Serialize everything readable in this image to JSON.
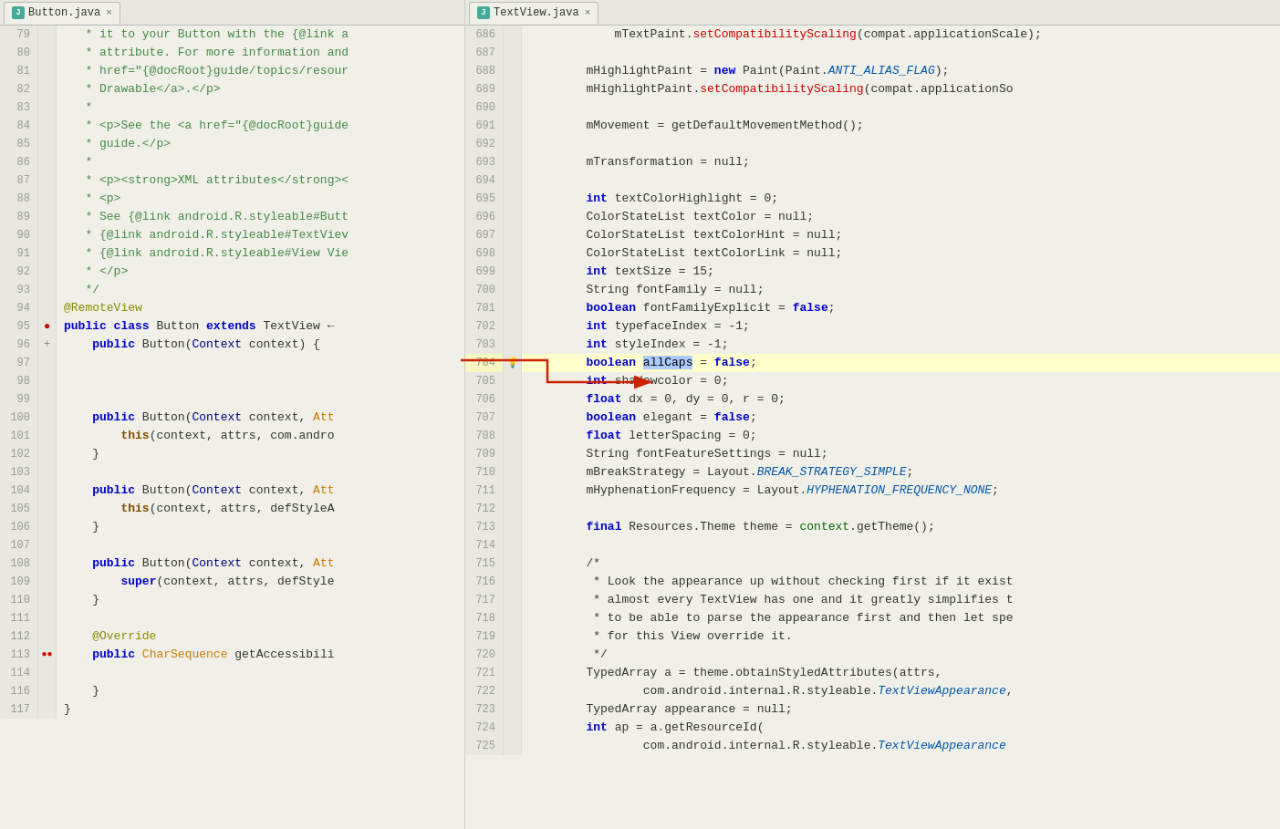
{
  "left_tab": {
    "icon_text": "J",
    "label": "Button.java",
    "close": "×"
  },
  "right_tab": {
    "icon_text": "J",
    "label": "TextView.java",
    "close": "×"
  },
  "left_lines": [
    {
      "num": "79",
      "gutter": "",
      "content": [
        {
          "t": "comment",
          "v": "   * it to your Button with the {@link a"
        }
      ]
    },
    {
      "num": "80",
      "gutter": "",
      "content": [
        {
          "t": "comment",
          "v": "   * attribute. For more information and"
        }
      ]
    },
    {
      "num": "81",
      "gutter": "",
      "content": [
        {
          "t": "comment",
          "v": "   * href=\"{@docRoot}guide/topics/resour"
        }
      ]
    },
    {
      "num": "82",
      "gutter": "",
      "content": [
        {
          "t": "comment",
          "v": "   * Drawable</a>.</p>"
        }
      ]
    },
    {
      "num": "83",
      "gutter": "",
      "content": [
        {
          "t": "comment",
          "v": "   *"
        }
      ]
    },
    {
      "num": "84",
      "gutter": "",
      "content": [
        {
          "t": "comment",
          "v": "   * <p>See the <a href=\"{@docRoot}guide"
        }
      ]
    },
    {
      "num": "85",
      "gutter": "",
      "content": [
        {
          "t": "comment",
          "v": "   * guide.</p>"
        }
      ]
    },
    {
      "num": "86",
      "gutter": "",
      "content": [
        {
          "t": "comment",
          "v": "   *"
        }
      ]
    },
    {
      "num": "87",
      "gutter": "",
      "content": [
        {
          "t": "comment",
          "v": "   * <p><strong>XML attributes</strong><"
        }
      ]
    },
    {
      "num": "88",
      "gutter": "",
      "content": [
        {
          "t": "comment",
          "v": "   * <p>"
        }
      ]
    },
    {
      "num": "89",
      "gutter": "",
      "content": [
        {
          "t": "comment",
          "v": "   * See {@link android.R.styleable#Butt"
        }
      ]
    },
    {
      "num": "90",
      "gutter": "",
      "content": [
        {
          "t": "comment",
          "v": "   * {@link android.R.styleable#TextViev"
        }
      ]
    },
    {
      "num": "91",
      "gutter": "",
      "content": [
        {
          "t": "comment",
          "v": "   * {@link android.R.styleable#View Vie"
        }
      ]
    },
    {
      "num": "92",
      "gutter": "",
      "content": [
        {
          "t": "comment",
          "v": "   * </p>"
        }
      ]
    },
    {
      "num": "93",
      "gutter": "",
      "content": [
        {
          "t": "comment",
          "v": "   */"
        }
      ]
    },
    {
      "num": "94",
      "gutter": "",
      "content": [
        {
          "t": "annotation",
          "v": "@RemoteView"
        }
      ]
    },
    {
      "num": "95",
      "gutter": "●",
      "content": [
        {
          "t": "kw",
          "v": "public class"
        },
        {
          "t": "normal",
          "v": " Button "
        },
        {
          "t": "kw",
          "v": "extends"
        },
        {
          "t": "normal",
          "v": " TextView ←"
        }
      ]
    },
    {
      "num": "96",
      "gutter": "+",
      "content": [
        {
          "t": "normal",
          "v": "    "
        },
        {
          "t": "kw",
          "v": "public"
        },
        {
          "t": "normal",
          "v": " Button("
        },
        {
          "t": "type",
          "v": "Context"
        },
        {
          "t": "normal",
          "v": " context) {"
        }
      ]
    },
    {
      "num": "97",
      "gutter": "",
      "content": []
    },
    {
      "num": "98",
      "gutter": "",
      "content": []
    },
    {
      "num": "99",
      "gutter": "",
      "content": []
    },
    {
      "num": "100",
      "gutter": "",
      "content": [
        {
          "t": "normal",
          "v": "    "
        },
        {
          "t": "kw",
          "v": "public"
        },
        {
          "t": "normal",
          "v": " Button("
        },
        {
          "t": "type",
          "v": "Context"
        },
        {
          "t": "normal",
          "v": " context, "
        },
        {
          "t": "param",
          "v": "Att"
        }
      ]
    },
    {
      "num": "101",
      "gutter": "",
      "content": [
        {
          "t": "normal",
          "v": "        "
        },
        {
          "t": "kw2",
          "v": "this"
        },
        {
          "t": "normal",
          "v": "(context, attrs, com.andro"
        }
      ]
    },
    {
      "num": "102",
      "gutter": "",
      "content": [
        {
          "t": "normal",
          "v": "    }"
        }
      ]
    },
    {
      "num": "103",
      "gutter": "",
      "content": []
    },
    {
      "num": "104",
      "gutter": "",
      "content": [
        {
          "t": "normal",
          "v": "    "
        },
        {
          "t": "kw",
          "v": "public"
        },
        {
          "t": "normal",
          "v": " Button("
        },
        {
          "t": "type",
          "v": "Context"
        },
        {
          "t": "normal",
          "v": " context, "
        },
        {
          "t": "param",
          "v": "Att"
        }
      ]
    },
    {
      "num": "105",
      "gutter": "",
      "content": [
        {
          "t": "normal",
          "v": "        "
        },
        {
          "t": "kw2",
          "v": "this"
        },
        {
          "t": "normal",
          "v": "(context, attrs, defStyleA"
        }
      ]
    },
    {
      "num": "106",
      "gutter": "",
      "content": [
        {
          "t": "normal",
          "v": "    }"
        }
      ]
    },
    {
      "num": "107",
      "gutter": "",
      "content": []
    },
    {
      "num": "108",
      "gutter": "",
      "content": [
        {
          "t": "normal",
          "v": "    "
        },
        {
          "t": "kw",
          "v": "public"
        },
        {
          "t": "normal",
          "v": " Button("
        },
        {
          "t": "type",
          "v": "Context"
        },
        {
          "t": "normal",
          "v": " context, "
        },
        {
          "t": "param",
          "v": "Att"
        }
      ]
    },
    {
      "num": "109",
      "gutter": "",
      "content": [
        {
          "t": "normal",
          "v": "        "
        },
        {
          "t": "kw",
          "v": "super"
        },
        {
          "t": "normal",
          "v": "(context, attrs, defStyle"
        }
      ]
    },
    {
      "num": "110",
      "gutter": "",
      "content": [
        {
          "t": "normal",
          "v": "    }"
        }
      ]
    },
    {
      "num": "111",
      "gutter": "",
      "content": []
    },
    {
      "num": "112",
      "gutter": "",
      "content": [
        {
          "t": "annotation2",
          "v": "    @Override"
        }
      ]
    },
    {
      "num": "113",
      "gutter": "●●",
      "content": [
        {
          "t": "normal",
          "v": "    "
        },
        {
          "t": "kw",
          "v": "public"
        },
        {
          "t": "normal",
          "v": " "
        },
        {
          "t": "type2",
          "v": "CharSequence"
        },
        {
          "t": "normal",
          "v": " getAccessibili"
        }
      ]
    },
    {
      "num": "114",
      "gutter": "",
      "content": []
    },
    {
      "num": "116",
      "gutter": "",
      "content": [
        {
          "t": "normal",
          "v": "    }"
        }
      ]
    },
    {
      "num": "117",
      "gutter": "",
      "content": [
        {
          "t": "normal",
          "v": "}"
        }
      ]
    }
  ],
  "right_lines": [
    {
      "num": "686",
      "gutter": "",
      "highlighted": false,
      "content": "            mTextPaint.<method>setCompatibilityScaling</method>(compat.applicationScale);"
    },
    {
      "num": "687",
      "gutter": "",
      "highlighted": false,
      "content": ""
    },
    {
      "num": "688",
      "gutter": "",
      "highlighted": false,
      "content": "        mHighlightPaint = <kw>new</kw> Paint(Paint.<italic>ANTI_ALIAS_FLAG</italic>);"
    },
    {
      "num": "689",
      "gutter": "",
      "highlighted": false,
      "content": "        mHighlightPaint.<method>setCompatibilityScaling</method>(compat.applicationSo"
    },
    {
      "num": "690",
      "gutter": "",
      "highlighted": false,
      "content": ""
    },
    {
      "num": "691",
      "gutter": "",
      "highlighted": false,
      "content": "        mMovement = getDefaultMovementMethod();"
    },
    {
      "num": "692",
      "gutter": "",
      "highlighted": false,
      "content": ""
    },
    {
      "num": "693",
      "gutter": "",
      "highlighted": false,
      "content": "        mTransformation = null;"
    },
    {
      "num": "694",
      "gutter": "",
      "highlighted": false,
      "content": ""
    },
    {
      "num": "695",
      "gutter": "",
      "highlighted": false,
      "content": "        <kw>int</kw> textColorHighlight = 0;"
    },
    {
      "num": "696",
      "gutter": "",
      "highlighted": false,
      "content": "        ColorStateList textColor = null;"
    },
    {
      "num": "697",
      "gutter": "",
      "highlighted": false,
      "content": "        ColorStateList textColorHint = null;"
    },
    {
      "num": "698",
      "gutter": "",
      "highlighted": false,
      "content": "        ColorStateList textColorLink = null;"
    },
    {
      "num": "699",
      "gutter": "",
      "highlighted": false,
      "content": "        <kw>int</kw> textSize = 15;"
    },
    {
      "num": "700",
      "gutter": "",
      "highlighted": false,
      "content": "        String fontFamily = null;"
    },
    {
      "num": "701",
      "gutter": "",
      "highlighted": false,
      "content": "        <kw>boolean</kw> fontFamilyExplicit = <kw>false</kw>;"
    },
    {
      "num": "702",
      "gutter": "",
      "highlighted": false,
      "content": "        <kw>int</kw> typefaceIndex = -1;"
    },
    {
      "num": "703",
      "gutter": "",
      "highlighted": false,
      "content": "        <kw>int</kw> styleIndex = -1;"
    },
    {
      "num": "704",
      "gutter": "💡",
      "highlighted": true,
      "content": "        <kw>boolean</kw> <highlight>allCaps</highlight> = <kw>false</kw>;"
    },
    {
      "num": "705",
      "gutter": "",
      "highlighted": false,
      "content": "        <kw>int</kw> shadowcolor = 0;"
    },
    {
      "num": "706",
      "gutter": "",
      "highlighted": false,
      "content": "        <kw>float</kw> dx = 0, dy = 0, r = 0;"
    },
    {
      "num": "707",
      "gutter": "",
      "highlighted": false,
      "content": "        <kw>boolean</kw> elegant = <kw>false</kw>;"
    },
    {
      "num": "708",
      "gutter": "",
      "highlighted": false,
      "content": "        <kw>float</kw> letterSpacing = 0;"
    },
    {
      "num": "709",
      "gutter": "",
      "highlighted": false,
      "content": "        String fontFeatureSettings = null;"
    },
    {
      "num": "710",
      "gutter": "",
      "highlighted": false,
      "content": "        mBreakStrategy = Layout.<italic>BREAK_STRATEGY_SIMPLE</italic>;"
    },
    {
      "num": "711",
      "gutter": "",
      "highlighted": false,
      "content": "        mHyphenationFrequency = Layout.<italic>HYPHENATION_FREQUENCY_NONE</italic>;"
    },
    {
      "num": "712",
      "gutter": "",
      "highlighted": false,
      "content": ""
    },
    {
      "num": "713",
      "gutter": "",
      "highlighted": false,
      "content": "        <kw>final</kw> Resources.Theme theme = <green>context</green>.getTheme();"
    },
    {
      "num": "714",
      "gutter": "",
      "highlighted": false,
      "content": ""
    },
    {
      "num": "715",
      "gutter": "",
      "highlighted": false,
      "content": "        /*"
    },
    {
      "num": "716",
      "gutter": "",
      "highlighted": false,
      "content": "         * Look the appearance up without checking first if it exist"
    },
    {
      "num": "717",
      "gutter": "",
      "highlighted": false,
      "content": "         * almost every TextView has one and it greatly simplifies t"
    },
    {
      "num": "718",
      "gutter": "",
      "highlighted": false,
      "content": "         * to be able to parse the appearance first and then let spe"
    },
    {
      "num": "719",
      "gutter": "",
      "highlighted": false,
      "content": "         * for this View override it."
    },
    {
      "num": "720",
      "gutter": "",
      "highlighted": false,
      "content": "         */"
    },
    {
      "num": "721",
      "gutter": "",
      "highlighted": false,
      "content": "        TypedArray a = theme.obtainStyledAttributes(attrs,"
    },
    {
      "num": "722",
      "gutter": "",
      "highlighted": false,
      "content": "                com.android.internal.R.styleable.<italic>TextViewAppearance</italic>,"
    },
    {
      "num": "723",
      "gutter": "",
      "highlighted": false,
      "content": "        TypedArray appearance = null;"
    },
    {
      "num": "724",
      "gutter": "",
      "highlighted": false,
      "content": "        <kw>int</kw> ap = a.getResourceId("
    },
    {
      "num": "725",
      "gutter": "",
      "highlighted": false,
      "content": "                com.android.internal.R.styleable.<italic>TextViewAppearance"
    }
  ],
  "colors": {
    "bg": "#f0f0e8",
    "bg_highlighted": "#ffffcc",
    "gutter_bg": "#e8e8e0",
    "line_num": "#999999",
    "kw": "#0000cc",
    "method": "#cc0000",
    "italic_blue": "#0055aa",
    "green": "#006600",
    "comment": "#448844",
    "param": "#cc7700",
    "highlight_word_bg": "#aaccff"
  }
}
